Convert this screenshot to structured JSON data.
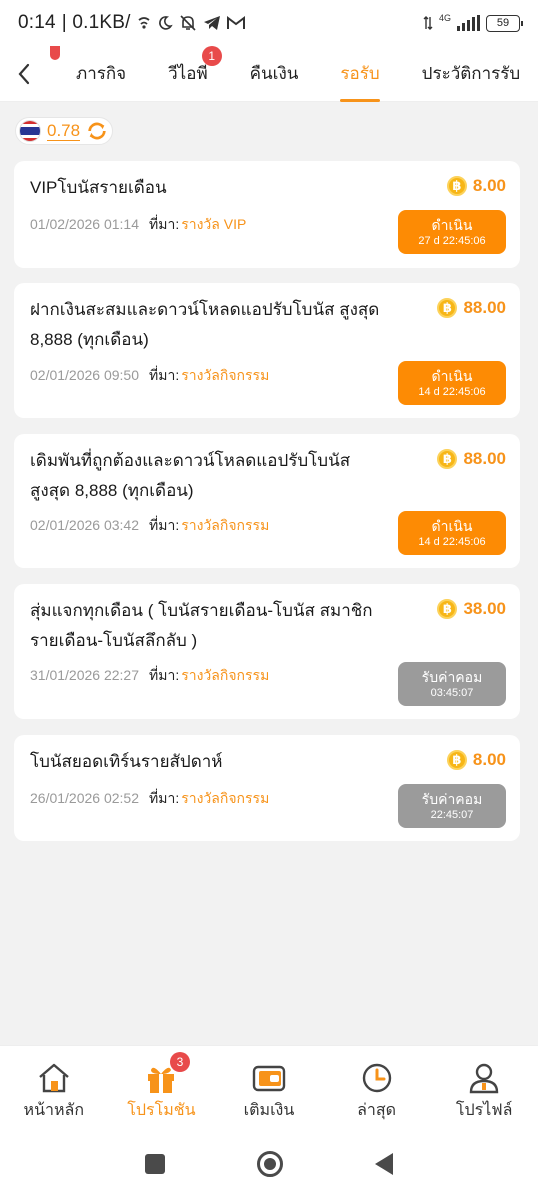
{
  "status_bar": {
    "time": "0:14",
    "speed": "| 0.1KB/",
    "network": "4G",
    "battery": "59"
  },
  "tabs": [
    {
      "label": "ภารกิจ",
      "active": false
    },
    {
      "label": "วีไอพี",
      "active": false,
      "badge": "1"
    },
    {
      "label": "คืนเงิน",
      "active": false
    },
    {
      "label": "รอรับ",
      "active": true
    },
    {
      "label": "ประวัติการรับ",
      "active": false
    }
  ],
  "balance": {
    "value": "0.78",
    "flag": "thailand-flag-icon"
  },
  "source_label": "ที่มา:",
  "cards": [
    {
      "title": "VIPโบนัสรายเดือน",
      "amount": "8.00",
      "date": "01/02/2026 01:14",
      "source": "รางวัล VIP",
      "button_label": "ดำเนิน",
      "button_timer": "27 d 22:45:06",
      "button_style": "orange"
    },
    {
      "title": "ฝากเงินสะสมและดาวน์โหลดแอปรับโบนัส สูงสุด 8,888 (ทุกเดือน)",
      "amount": "88.00",
      "date": "02/01/2026 09:50",
      "source": "รางวัลกิจกรรม",
      "button_label": "ดำเนิน",
      "button_timer": "14 d 22:45:06",
      "button_style": "orange"
    },
    {
      "title": "เดิมพันที่ถูกต้องและดาวน์โหลดแอปรับโบนัส สูงสุด 8,888 (ทุกเดือน)",
      "amount": "88.00",
      "date": "02/01/2026 03:42",
      "source": "รางวัลกิจกรรม",
      "button_label": "ดำเนิน",
      "button_timer": "14 d 22:45:06",
      "button_style": "orange"
    },
    {
      "title": "สุ่มแจกทุกเดือน ( โบนัสรายเดือน-โบนัส สมาชิกรายเดือน-โบนัสลึกลับ )",
      "amount": "38.00",
      "date": "31/01/2026 22:27",
      "source": "รางวัลกิจกรรม",
      "button_label": "รับค่าคอม",
      "button_timer": "03:45:07",
      "button_style": "gray"
    },
    {
      "title": "โบนัสยอดเทิร์นรายสัปดาห์",
      "amount": "8.00",
      "date": "26/01/2026 02:52",
      "source": "รางวัลกิจกรรม",
      "button_label": "รับค่าคอม",
      "button_timer": "22:45:07",
      "button_style": "gray"
    }
  ],
  "coin_symbol": "฿",
  "bottom_nav": [
    {
      "label": "หน้าหลัก",
      "icon": "home-icon",
      "active": false
    },
    {
      "label": "โปรโมชัน",
      "icon": "gift-icon",
      "active": true,
      "badge": "3"
    },
    {
      "label": "เติมเงิน",
      "icon": "wallet-icon",
      "active": false
    },
    {
      "label": "ล่าสุด",
      "icon": "clock-icon",
      "active": false
    },
    {
      "label": "โปรไฟล์",
      "icon": "profile-icon",
      "active": false
    }
  ],
  "colors": {
    "accent": "#f7931a",
    "button_active": "#fd8b04",
    "button_disabled": "#9b9b9b",
    "badge": "#e84a4a"
  }
}
